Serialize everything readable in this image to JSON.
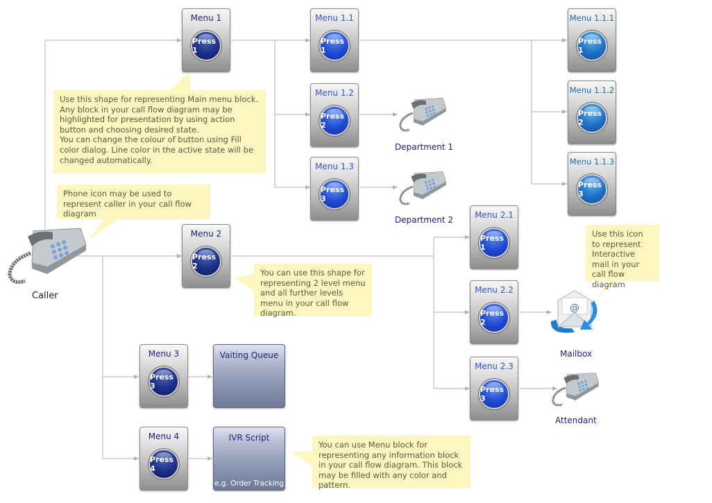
{
  "caller": {
    "label": "Caller"
  },
  "menus": {
    "m1": {
      "title": "Menu 1",
      "button": "Press 1"
    },
    "m11": {
      "title": "Menu 1.1",
      "button": "Press 1"
    },
    "m12": {
      "title": "Menu 1.2",
      "button": "Press 2"
    },
    "m13": {
      "title": "Menu 1.3",
      "button": "Press 3"
    },
    "m111": {
      "title": "Menu 1.1.1",
      "button": "Press 1"
    },
    "m112": {
      "title": "Menu 1.1.2",
      "button": "Press 2"
    },
    "m113": {
      "title": "Menu 1.1.3",
      "button": "Press 3"
    },
    "m2": {
      "title": "Menu 2",
      "button": "Press 2"
    },
    "m21": {
      "title": "Menu 2.1",
      "button": "Press 1"
    },
    "m22": {
      "title": "Menu 2.2",
      "button": "Press 2"
    },
    "m23": {
      "title": "Menu 2.3",
      "button": "Press 3"
    },
    "m3": {
      "title": "Menu 3",
      "button": "Press 3"
    },
    "m4": {
      "title": "Menu 4",
      "button": "Press 4"
    }
  },
  "blocks": {
    "queue": {
      "title": "Vaiting Queue",
      "sub": ""
    },
    "ivr": {
      "title": "IVR Script",
      "sub": "e.g. Order Tracking"
    }
  },
  "endpoints": {
    "dept1": "Department 1",
    "dept2": "Department 2",
    "mailbox": "Mailbox",
    "attendant": "Attendant"
  },
  "notes": {
    "main_menu": "Use this shape for representing Main menu block. Any block in your call flow diagram may be highlighted for presentation by using action button and choosing desired state.\nYou can change the colour of button using Fill color dialog. Line color in the active state will be changed automatically.",
    "phone": "Phone icon may be used to represent caller in your call flow diagram",
    "level2": "You can use this shape for representing 2 level menu and all further levels menu in your call flow diagram.",
    "mail": "Use this icon to represent Interactive mail in your call flow diagram",
    "info_block": "You can use Menu block for representing any information block in your call flow diagram. This block may be filled with any color and pattern."
  },
  "colors": {
    "note_bg": "#fdf6c1",
    "connector": "#b0b0b0",
    "label": "#1a237e"
  }
}
